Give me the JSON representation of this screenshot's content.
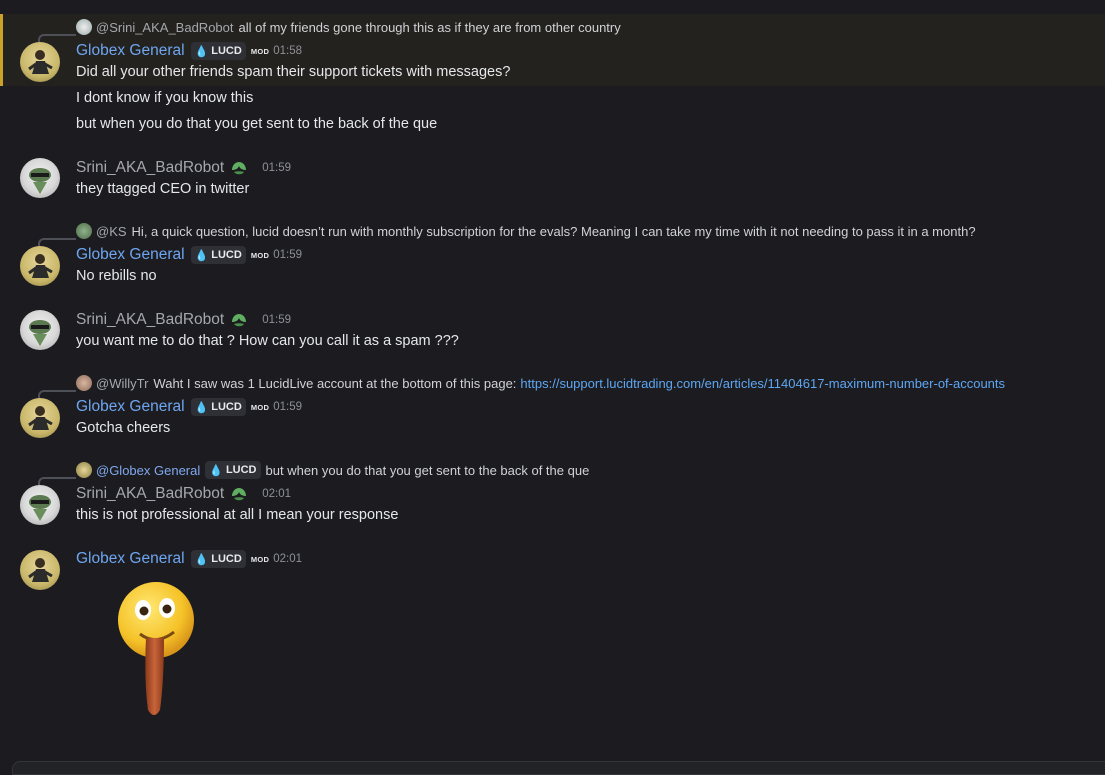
{
  "messages": [
    {
      "reply": {
        "user": "@Srini_AKA_BadRobot",
        "text": "all of my friends gone through this as if they are from other country"
      },
      "author": "Globex General",
      "tag": "LUCD",
      "mod": "MOD",
      "time": "01:58",
      "lines": [
        "Did all your other friends spam their support tickets with messages?",
        "I dont know if you know this",
        "but when you do that you get sent to the back of the que"
      ]
    },
    {
      "author": "Srini_AKA_BadRobot",
      "time": "01:59",
      "lines": [
        "they ttagged CEO in twitter"
      ]
    },
    {
      "reply": {
        "user": "@KS",
        "text": "Hi, a quick question, lucid doesn’t run with monthly subscription for the evals? Meaning I can take my time with it not needing to pass it in a month?"
      },
      "author": "Globex General",
      "tag": "LUCD",
      "mod": "MOD",
      "time": "01:59",
      "lines": [
        "No rebills no"
      ]
    },
    {
      "author": "Srini_AKA_BadRobot",
      "time": "01:59",
      "lines": [
        "you want me to do that ? How can you call it as a spam  ???"
      ]
    },
    {
      "reply": {
        "user": "@WillyTr",
        "text": "Waht I saw was 1 LucidLive account at the bottom of this page:",
        "link": "https://support.lucidtrading.com/en/articles/11404617-maximum-number-of-accounts"
      },
      "author": "Globex General",
      "tag": "LUCD",
      "mod": "MOD",
      "time": "01:59",
      "lines": [
        "Gotcha cheers"
      ]
    },
    {
      "reply": {
        "user": "@Globex General",
        "tag": "LUCD",
        "text": "but when you do that you get sent to the back of the que"
      },
      "author": "Srini_AKA_BadRobot",
      "time": "02:01",
      "lines": [
        "this is not professional at all I mean your response"
      ]
    },
    {
      "author": "Globex General",
      "tag": "LUCD",
      "mod": "MOD",
      "time": "02:01",
      "sticker": "tongue-out-emoji-sticker"
    }
  ],
  "colors": {
    "background": "#1c1c20",
    "highlight": "#24221f",
    "highlight_border": "#c9a227",
    "globex_name": "#6ea6f0",
    "srini_name": "#a4a7ad",
    "link": "#5ea6f2"
  }
}
